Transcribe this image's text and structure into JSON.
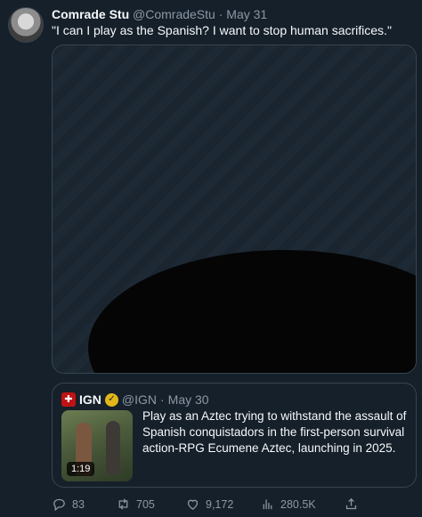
{
  "tweet": {
    "author_name": "Comrade Stu",
    "author_handle": "@ComradeStu",
    "date": "May 31",
    "text": "\"I can I play as the Spanish? I want to stop human sacrifices.\""
  },
  "quoted": {
    "author_name": "IGN",
    "author_handle": "@IGN",
    "date": "May 30",
    "video_duration": "1:19",
    "text_lines": [
      "Play as an Aztec trying to withstand the assault of",
      "Spanish conquistadors in the first-person survival",
      "action-RPG Ecumene Aztec, launching in 2025."
    ]
  },
  "actions": {
    "replies": "83",
    "retweets": "705",
    "likes": "9,172",
    "views": "280.5K"
  },
  "icons": {
    "reply": "reply-icon",
    "retweet": "retweet-icon",
    "like": "heart-icon",
    "views": "bar-chart-icon",
    "share": "share-icon"
  },
  "colors": {
    "background": "#15202b",
    "border": "#38444d",
    "secondary_text": "#8b98a5",
    "ign_red": "#bf1313",
    "verified_gold": "#e2b719"
  }
}
